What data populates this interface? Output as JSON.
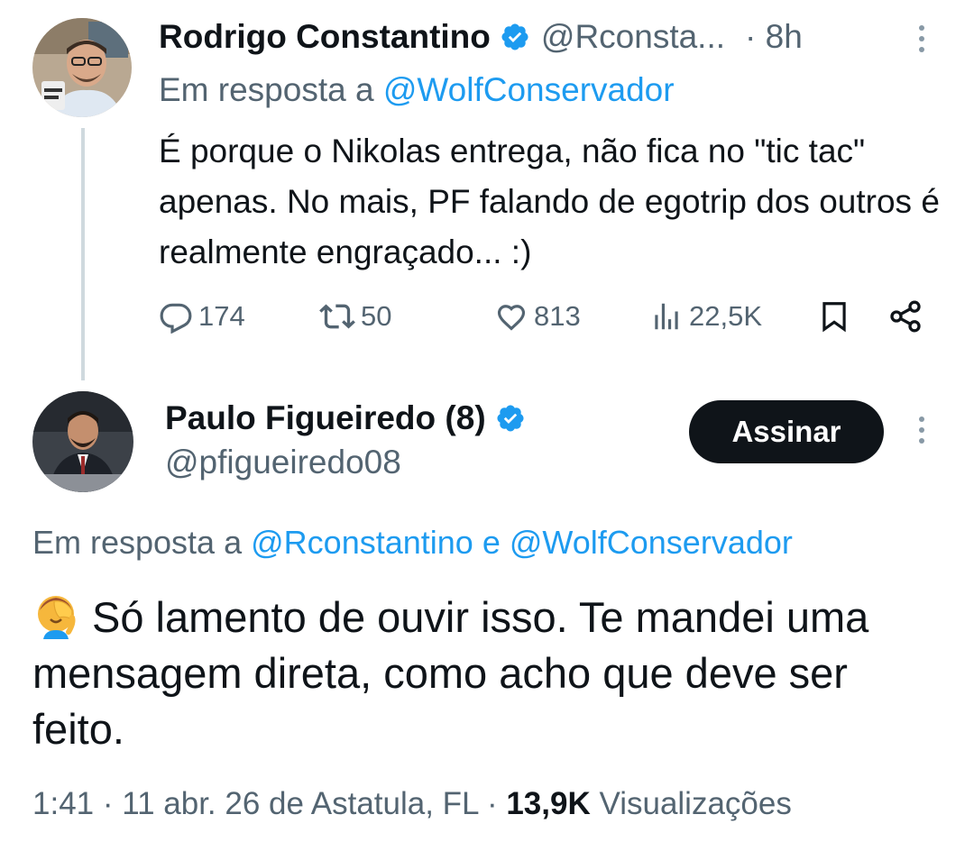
{
  "tweet1": {
    "author_name": "Rodrigo Constantino",
    "handle": "@Rconsta...",
    "time": "· 8h",
    "reply_prefix": "Em resposta a",
    "reply_mention": "@WolfConservador",
    "text": "É porque o Nikolas entrega, não fica no \"tic tac\" apenas. No mais, PF falando de egotrip dos outros é realmente engraçado... :)",
    "actions": {
      "replies": "174",
      "reposts": "50",
      "likes": "813",
      "views": "22,5K"
    }
  },
  "tweet2": {
    "author_name": "Paulo Figueiredo (8)",
    "handle": "@pfigueiredo08",
    "subscribe_label": "Assinar",
    "reply_prefix": "Em resposta a",
    "reply_mention_1": "@Rconstantino",
    "reply_conjunction": "e",
    "reply_mention_2": "@WolfConservador",
    "text": "Só lamento de ouvir isso. Te mandei uma mensagem direta, como acho que deve ser feito.",
    "emoji": "face-palm",
    "meta_prefix": "1:41 · 11 abr. 26 de Astatula, FL ·",
    "views_count": "13,9K",
    "views_label": "Visualizações"
  },
  "colors": {
    "accent": "#1d9bf0",
    "text_primary": "#0f1419",
    "text_secondary": "#536471",
    "thread_line": "#cfd9de",
    "button_dark": "#0f1419"
  },
  "icons": [
    "reply-icon",
    "repost-icon",
    "like-icon",
    "views-icon",
    "bookmark-icon",
    "share-icon",
    "verified-badge-icon",
    "more-options-icon",
    "face-palm-emoji"
  ]
}
